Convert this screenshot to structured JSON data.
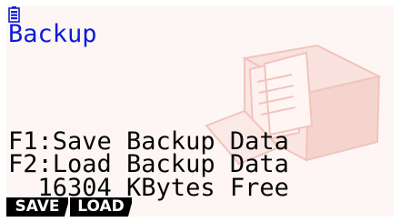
{
  "screen": {
    "title": "Backup",
    "status": {
      "battery_icon": "battery-icon"
    },
    "options": [
      {
        "key": "F1",
        "text": "F1:Save Backup Data"
      },
      {
        "key": "F2",
        "text": "F2:Load Backup Data"
      }
    ],
    "free_space": "  16304 KBytes Free",
    "function_keys": [
      {
        "label": "SAVE"
      },
      {
        "label": "LOAD"
      }
    ],
    "colors": {
      "title": "#0c1cd8",
      "text": "#050505",
      "background": "#fdf6f4",
      "art": "#f3c9c2"
    }
  }
}
